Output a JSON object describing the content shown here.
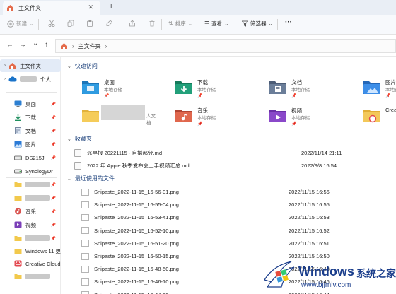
{
  "window": {
    "tab_title": "主文件夹",
    "close_glyph": "✕",
    "add_tab_glyph": "+"
  },
  "toolbar": {
    "new_label": "新建",
    "sort_label": "排序",
    "view_label": "查看",
    "filter_label": "筛选器",
    "more_glyph": "···"
  },
  "address": {
    "current": "主文件夹",
    "back_glyph": "←",
    "forward_glyph": "→",
    "down_glyph": "⌄",
    "up_glyph": "↑"
  },
  "sidebar": {
    "home_label": "主文件夹",
    "personal_label": "个人",
    "items": [
      {
        "label": "桌面",
        "icon": "desktop-icon",
        "color": "#2c7fd1"
      },
      {
        "label": "下载",
        "icon": "download-icon",
        "color": "#1f8f5e"
      },
      {
        "label": "文档",
        "icon": "documents-icon",
        "color": "#5a6e8c"
      },
      {
        "label": "图片",
        "icon": "pictures-icon",
        "color": "#2b7ad6"
      },
      {
        "label": "DS215J",
        "icon": "drive-icon",
        "color": "#555555"
      },
      {
        "label": "SynologyDr",
        "icon": "drive-icon",
        "color": "#555555"
      },
      {
        "label": "",
        "icon": "folder-icon",
        "color": "#f2c94c"
      },
      {
        "label": "",
        "icon": "folder-icon",
        "color": "#f2c94c"
      },
      {
        "label": "音乐",
        "icon": "music-icon",
        "color": "#d9534f"
      },
      {
        "label": "视频",
        "icon": "video-icon",
        "color": "#7b3fb8"
      },
      {
        "label": "",
        "icon": "folder-icon",
        "color": "#f2c94c"
      },
      {
        "label": "Windows 11 更",
        "icon": "folder-icon",
        "color": "#f2c94c"
      },
      {
        "label": "Creative Cloud",
        "icon": "creative-cloud-icon",
        "color": "#e34850"
      },
      {
        "label": "",
        "icon": "folder-icon",
        "color": "#f2c94c"
      }
    ]
  },
  "quick_access": {
    "heading": "快速访问",
    "sub_label": "本地存储",
    "tiles": [
      {
        "name": "桌面",
        "sub": "本地存储",
        "icon": "desktop-folder-icon"
      },
      {
        "name": "下载",
        "sub": "本地存储",
        "icon": "download-folder-icon"
      },
      {
        "name": "文档",
        "sub": "本地存储",
        "icon": "documents-folder-icon"
      },
      {
        "name": "图片",
        "sub": "本地存储",
        "icon": "pictures-folder-icon"
      },
      {
        "name": "",
        "sub": "人文档",
        "icon": "folder-icon"
      },
      {
        "name": "音乐",
        "sub": "本地存储",
        "icon": "music-folder-icon"
      },
      {
        "name": "视频",
        "sub": "本地存储",
        "icon": "video-folder-icon"
      },
      {
        "name": "Crea",
        "sub": "",
        "icon": "creative-cloud-folder-icon"
      }
    ]
  },
  "favorites": {
    "heading": "收藏夹",
    "items": [
      {
        "name": "派早报 20221115 - 自拟部分.md",
        "date": "2022/11/14 21:11"
      },
      {
        "name": "2022 年 Apple 秋季发布会上手视频汇总.md",
        "date": "2022/9/8 16:54"
      }
    ]
  },
  "recent": {
    "heading": "最近使用的文件",
    "items": [
      {
        "name": "Snipaste_2022-11-15_16-56-01.png",
        "date": "2022/11/15 16:56"
      },
      {
        "name": "Snipaste_2022-11-15_16-55-04.png",
        "date": "2022/11/15 16:55"
      },
      {
        "name": "Snipaste_2022-11-15_16-53-41.png",
        "date": "2022/11/15 16:53"
      },
      {
        "name": "Snipaste_2022-11-15_16-52-10.png",
        "date": "2022/11/15 16:52"
      },
      {
        "name": "Snipaste_2022-11-15_16-51-20.png",
        "date": "2022/11/15 16:51"
      },
      {
        "name": "Snipaste_2022-11-15_16-50-15.png",
        "date": "2022/11/15 16:50"
      },
      {
        "name": "Snipaste_2022-11-15_16-48-50.png",
        "date": "2022/11/15 16:48"
      },
      {
        "name": "Snipaste_2022-11-15_16-46-10.png",
        "date": "2022/11/15 16:46"
      },
      {
        "name": "Snipaste_2022-11-15_16-44-39.png",
        "date": "2022/11/15 16:44"
      }
    ]
  },
  "watermark": {
    "brand": "Windows",
    "brand_cn": "系统之家",
    "url": "www.bjjmlv.com"
  },
  "colors": {
    "accent": "#1a3f7a",
    "selected_bg": "#e3ebf7",
    "tab_bg": "#e9eef5"
  }
}
